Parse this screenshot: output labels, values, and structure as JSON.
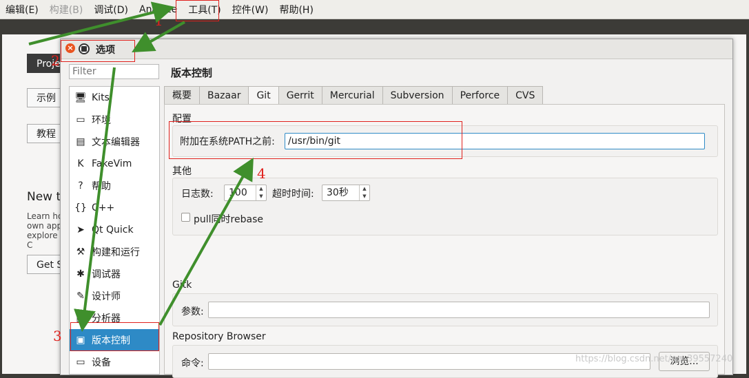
{
  "menubar": {
    "items": [
      {
        "label": "编辑(E)",
        "enabled": true
      },
      {
        "label": "构建(B)",
        "enabled": false
      },
      {
        "label": "调试(D)",
        "enabled": true
      },
      {
        "label": "Analyze",
        "enabled": true
      },
      {
        "label": "工具(T)",
        "enabled": true
      },
      {
        "label": "控件(W)",
        "enabled": true
      },
      {
        "label": "帮助(H)",
        "enabled": true
      }
    ]
  },
  "welcome": {
    "projects": "Proje",
    "examples": "示例",
    "tutorials": "教程",
    "new_to": "New t",
    "learn_lines": [
      "Learn ho",
      "own appl",
      "explore C"
    ],
    "get_started": "Get S"
  },
  "dialog": {
    "title": "选项",
    "close_glyph": "×",
    "filter_placeholder": "Filter",
    "categories": [
      {
        "label": "Kits",
        "icon": "kits-icon",
        "glyph": "🖥"
      },
      {
        "label": "环境",
        "icon": "monitor-icon",
        "glyph": "▭"
      },
      {
        "label": "文本编辑器",
        "icon": "text-editor-icon",
        "glyph": "▤"
      },
      {
        "label": "FakeVim",
        "icon": "fakevim-icon",
        "glyph": "K"
      },
      {
        "label": "帮助",
        "icon": "help-icon",
        "glyph": "?"
      },
      {
        "label": "C++",
        "icon": "cpp-icon",
        "glyph": "{}"
      },
      {
        "label": "Qt Quick",
        "icon": "qt-quick-icon",
        "glyph": "➤"
      },
      {
        "label": "构建和运行",
        "icon": "hammer-icon",
        "glyph": "⚒"
      },
      {
        "label": "调试器",
        "icon": "bug-icon",
        "glyph": "✱"
      },
      {
        "label": "设计师",
        "icon": "pen-icon",
        "glyph": "✎"
      },
      {
        "label": "分析器",
        "icon": "analyzer-icon",
        "glyph": "▥"
      },
      {
        "label": "版本控制",
        "icon": "version-control-icon",
        "glyph": "▣",
        "selected": true
      },
      {
        "label": "设备",
        "icon": "device-icon",
        "glyph": "▭"
      }
    ],
    "page_title": "版本控制",
    "tabs": [
      "概要",
      "Bazaar",
      "Git",
      "Gerrit",
      "Mercurial",
      "Subversion",
      "Perforce",
      "CVS"
    ],
    "active_tab": "Git",
    "config": {
      "group_label": "配置",
      "path_label": "附加在系统PATH之前:",
      "path_value": "/usr/bin/git"
    },
    "misc": {
      "group_label": "其他",
      "log_count_label": "日志数:",
      "log_count_value": "100",
      "timeout_label": "超时时间:",
      "timeout_value": "30秒",
      "pull_rebase_label": "pull同时rebase",
      "pull_rebase_checked": false
    },
    "gitk": {
      "group_label": "Gitk",
      "args_label": "参数:",
      "args_value": ""
    },
    "repo_browser": {
      "group_label": "Repository Browser",
      "command_label": "命令:",
      "command_value": "",
      "browse_button": "浏览..."
    }
  },
  "annotations": {
    "step_numbers": [
      "1",
      "2",
      "3",
      "4"
    ],
    "color": "#e0201c",
    "arrow_color": "#3f8f2c"
  },
  "watermark": "https://blog.csdn.net/qq_39557240"
}
